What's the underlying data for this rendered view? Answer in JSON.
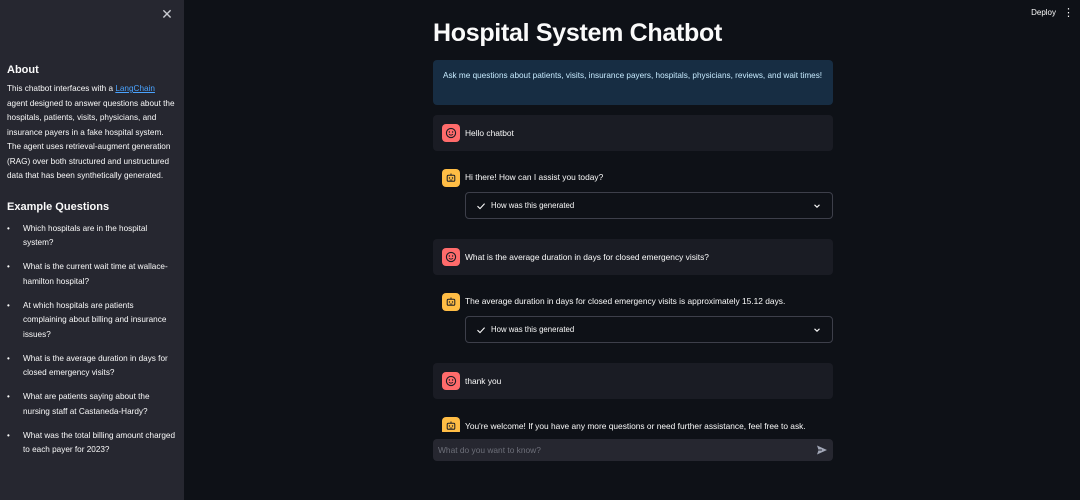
{
  "sidebar": {
    "close_icon": "✕",
    "about_heading": "About",
    "about_text_before": "This chatbot interfaces with a ",
    "about_link": "LangChain",
    "about_text_after": " agent designed to answer questions about the hospitals, patients, visits, physicians, and insurance payers in a fake hospital system. The agent uses retrieval-augment generation (RAG) over both structured and unstructured data that has been synthetically generated.",
    "examples_heading": "Example Questions",
    "questions": [
      "Which hospitals are in the hospital system?",
      "What is the current wait time at wallace-hamilton hospital?",
      "At which hospitals are patients complaining about billing and insurance issues?",
      "What is the average duration in days for closed emergency visits?",
      "What are patients saying about the nursing staff at Castaneda-Hardy?",
      "What was the total billing amount charged to each payer for 2023?"
    ]
  },
  "header": {
    "deploy_label": "Deploy",
    "menu_icon": "⋮"
  },
  "main": {
    "title": "Hospital System Chatbot",
    "info": "Ask me questions about patients, visits, insurance payers, hospitals, physicians, reviews, and wait times!",
    "messages": [
      {
        "role": "user",
        "text": "Hello chatbot"
      },
      {
        "role": "assistant",
        "text": "Hi there! How can I assist you today?",
        "expander": "How was this generated"
      },
      {
        "role": "user",
        "text": "What is the average duration in days for closed emergency visits?"
      },
      {
        "role": "assistant",
        "text": "The average duration in days for closed emergency visits is approximately 15.12 days.",
        "expander": "How was this generated"
      },
      {
        "role": "user",
        "text": "thank you"
      },
      {
        "role": "assistant",
        "text": "You're welcome! If you have any more questions or need further assistance, feel free to ask."
      }
    ],
    "input_placeholder": "What do you want to know?"
  },
  "colors": {
    "user_avatar": "#ff6b6b",
    "assistant_avatar": "#ffbd45",
    "link": "#4aa3ff",
    "info_bg": "#172d43"
  }
}
